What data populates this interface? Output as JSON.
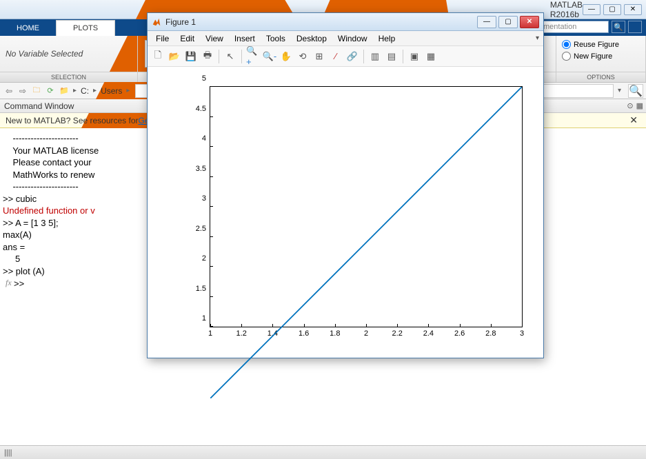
{
  "app": {
    "title": "MATLAB R2016b"
  },
  "win_controls": {
    "minimize": "—",
    "maximize": "▢",
    "close": "✕"
  },
  "ribbon": {
    "tabs": [
      {
        "label": "HOME",
        "active": false
      },
      {
        "label": "PLOTS",
        "active": true
      }
    ],
    "search_placeholder": "mentation",
    "selection_label": "SELECTION",
    "no_variable": "No Variable Selected",
    "options_label": "OPTIONS",
    "options": {
      "reuse": "Reuse Figure",
      "newfig": "New Figure"
    }
  },
  "path": {
    "drive": "C:",
    "segs": [
      "Users"
    ]
  },
  "cmd_header": "Command Window",
  "banner": {
    "text": "New to MATLAB? See resources for ",
    "link": "Ge"
  },
  "cmd_lines": [
    "    ----------------------",
    "    Your MATLAB license",
    "    Please contact your",
    "    MathWorks to renew ",
    "    ----------------------",
    "",
    ">> cubic"
  ],
  "cmd_error": "Undefined function or v",
  "cmd_lines2": [
    "",
    ">> A = [1 3 5];",
    "max(A)",
    "",
    "ans =",
    "",
    "     5",
    "",
    ">> plot (A)",
    ">> "
  ],
  "status": "||||",
  "figure": {
    "title": "Figure 1",
    "menus": [
      "File",
      "Edit",
      "View",
      "Insert",
      "Tools",
      "Desktop",
      "Window",
      "Help"
    ],
    "yticks": [
      "1",
      "1.5",
      "2",
      "2.5",
      "3",
      "3.5",
      "4",
      "4.5",
      "5"
    ],
    "xticks": [
      "1",
      "1.2",
      "1.4",
      "1.6",
      "1.8",
      "2",
      "2.2",
      "2.4",
      "2.6",
      "2.8",
      "3"
    ]
  },
  "chart_data": {
    "type": "line",
    "x": [
      1,
      2,
      3
    ],
    "y": [
      1,
      3,
      5
    ],
    "xlabel": "",
    "ylabel": "",
    "xlim": [
      1,
      3
    ],
    "ylim": [
      1,
      5
    ],
    "title": ""
  }
}
